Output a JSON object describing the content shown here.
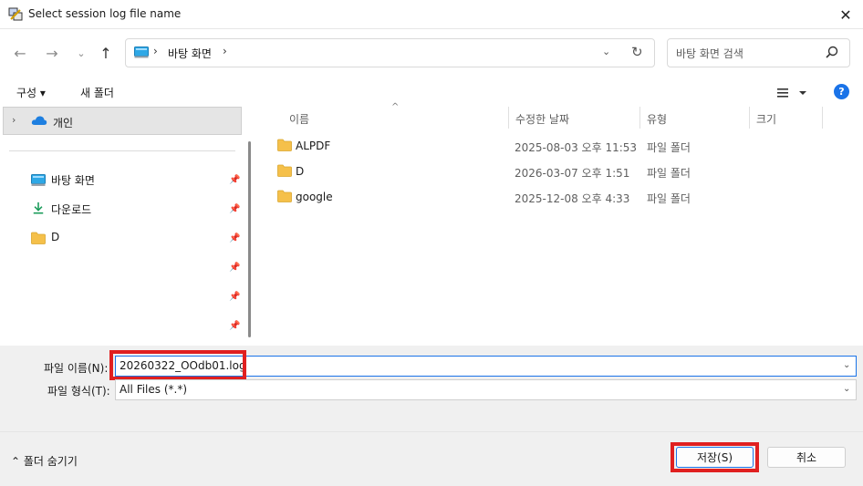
{
  "window": {
    "title": "Select session log file name",
    "close_glyph": "✕"
  },
  "nav": {
    "back_glyph": "←",
    "forward_glyph": "→",
    "recent_glyph": "⌄",
    "up_glyph": "↑"
  },
  "address": {
    "separator": "›",
    "crumb": "바탕 화면",
    "dropdown_glyph": "⌄",
    "refresh_glyph": "↻"
  },
  "search": {
    "placeholder": "바탕 화면 검색"
  },
  "toolbar": {
    "organize_label": "구성 ▾",
    "new_folder_label": "새 폴더",
    "help_glyph": "?"
  },
  "sidebar": {
    "expand_glyph": "›",
    "personal_label": "개인",
    "items": [
      {
        "label": "바탕 화면",
        "icon": "desktop-icon"
      },
      {
        "label": "다운로드",
        "icon": "download-icon"
      },
      {
        "label": "D",
        "icon": "folder-icon"
      }
    ],
    "pin_glyph": "📌"
  },
  "columns": {
    "name": "이름",
    "date": "수정한 날짜",
    "type": "유형",
    "size": "크기",
    "sort_glyph": "^"
  },
  "files": [
    {
      "name": "ALPDF",
      "date": "2025-08-03 오후 11:53",
      "type": "파일 폴더"
    },
    {
      "name": "D",
      "date": "2026-03-07 오후 1:51",
      "type": "파일 폴더"
    },
    {
      "name": "google",
      "date": "2025-12-08 오후 4:33",
      "type": "파일 폴더"
    }
  ],
  "form": {
    "filename_label": "파일 이름(N):",
    "filename_value": "20260322_OOdb01.log",
    "filetype_label": "파일 형식(T):",
    "filetype_value": "All Files (*.*)",
    "dropdown_glyph": "⌄"
  },
  "footer": {
    "hide_folders_label": "⌃ 폴더 숨기기",
    "save_label": "저장(S)",
    "cancel_label": "취소"
  },
  "colors": {
    "accent": "#1a73e8",
    "highlight": "#e02020",
    "folder": "#f5c04a"
  }
}
